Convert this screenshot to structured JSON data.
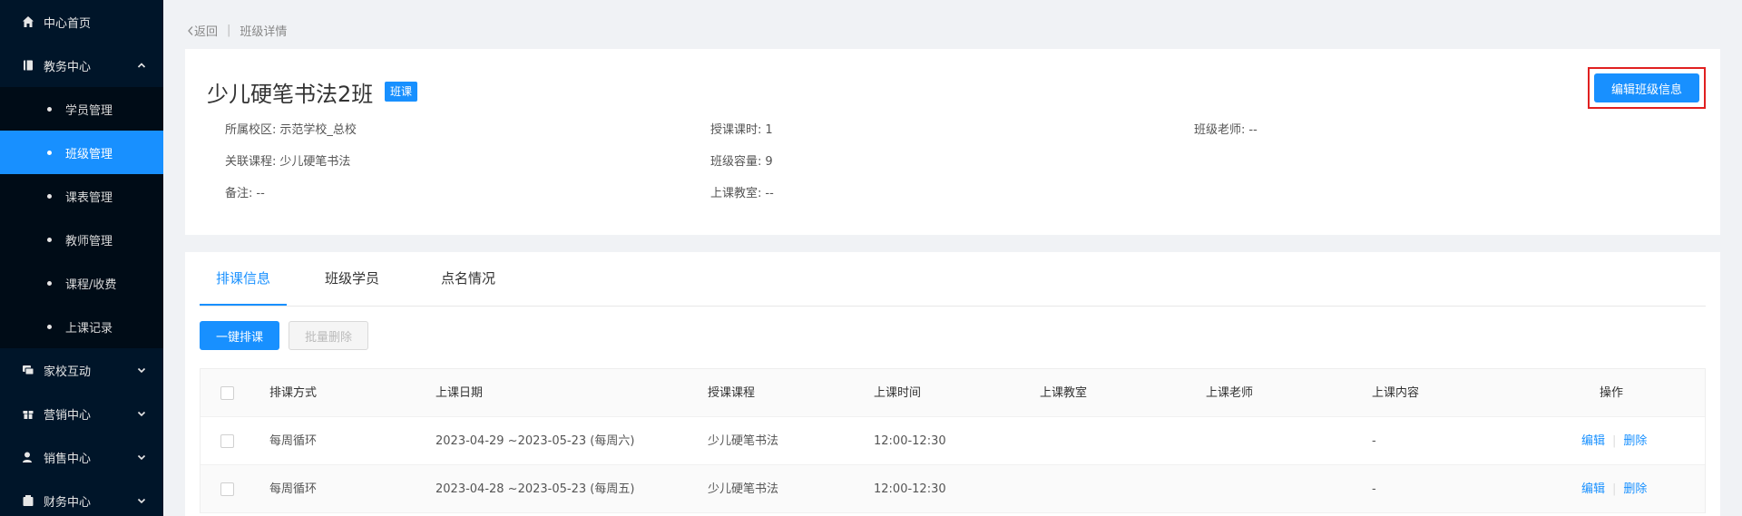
{
  "sidebar": {
    "items": [
      {
        "label": "中心首页",
        "icon": "home-icon"
      },
      {
        "label": "教务中心",
        "icon": "book-icon",
        "expanded": true,
        "children": [
          "学员管理",
          "班级管理",
          "课表管理",
          "教师管理",
          "课程/收费",
          "上课记录"
        ],
        "active_child": "班级管理"
      },
      {
        "label": "家校互动",
        "icon": "chat-icon"
      },
      {
        "label": "营销中心",
        "icon": "gift-icon"
      },
      {
        "label": "销售中心",
        "icon": "user-icon"
      },
      {
        "label": "财务中心",
        "icon": "finance-icon"
      }
    ]
  },
  "breadcrumb": {
    "back": "返回",
    "separator": "|",
    "current": "班级详情"
  },
  "class_info": {
    "title": "少儿硬笔书法2班",
    "badge": "班课",
    "edit_button": "编辑班级信息",
    "campus_label": "所属校区:",
    "campus_value": "示范学校_总校",
    "course_label": "关联课程:",
    "course_value": "少儿硬笔书法",
    "remark_label": "备注:",
    "remark_value": "--",
    "hours_label": "授课课时:",
    "hours_value": "1",
    "capacity_label": "班级容量:",
    "capacity_value": "9",
    "room_label": "上课教室:",
    "room_value": "--",
    "teacher_label": "班级老师:",
    "teacher_value": "--"
  },
  "tabs": [
    "排课信息",
    "班级学员",
    "点名情况"
  ],
  "active_tab": "排课信息",
  "actions": {
    "auto_schedule": "一键排课",
    "batch_delete": "批量删除"
  },
  "table": {
    "headers": [
      "排课方式",
      "上课日期",
      "授课课程",
      "上课时间",
      "上课教室",
      "上课老师",
      "上课内容",
      "操作"
    ],
    "rows": [
      {
        "mode": "每周循环",
        "date": "2023-04-29 ~2023-05-23 (每周六)",
        "course": "少儿硬笔书法",
        "time": "12:00-12:30",
        "room": "",
        "teacher": "",
        "content": "-",
        "edit": "编辑",
        "delete": "删除"
      },
      {
        "mode": "每周循环",
        "date": "2023-04-28 ~2023-05-23 (每周五)",
        "course": "少儿硬笔书法",
        "time": "12:00-12:30",
        "room": "",
        "teacher": "",
        "content": "-",
        "edit": "编辑",
        "delete": "删除"
      }
    ]
  },
  "colors": {
    "primary": "#1890ff",
    "sidebar_bg": "#001529",
    "highlight_border": "#e02020"
  }
}
